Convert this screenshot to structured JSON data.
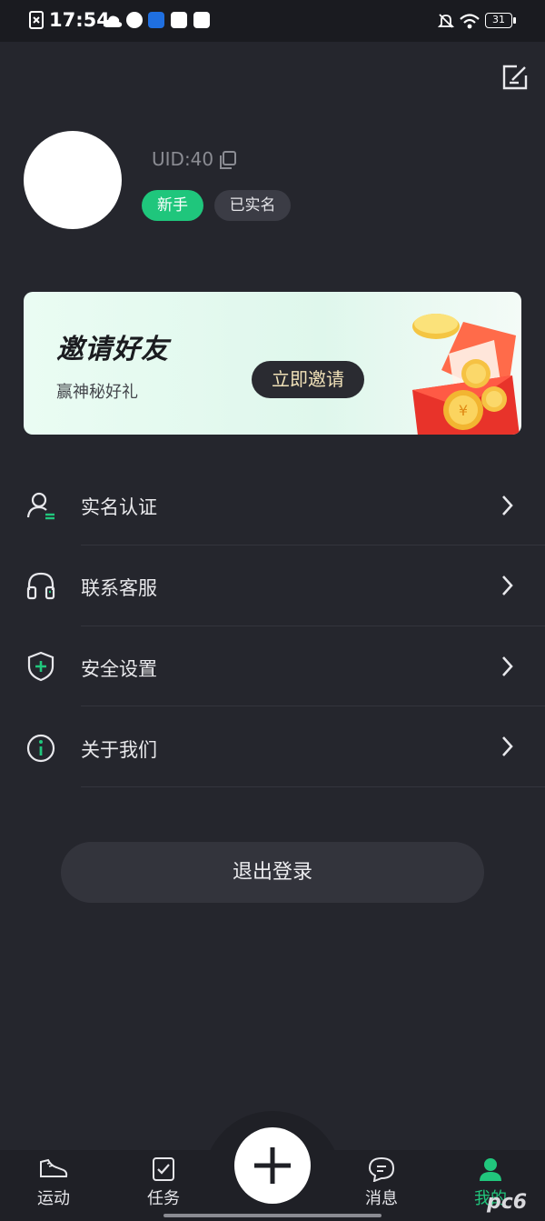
{
  "status_bar": {
    "time": "17:54",
    "battery": "31"
  },
  "profile": {
    "uid": "UID:40",
    "badge_new": "新手",
    "badge_verified": "已实名"
  },
  "banner": {
    "title": "邀请好友",
    "subtitle": "赢神秘好礼",
    "button": "立即邀请"
  },
  "menu": {
    "items": [
      {
        "label": "实名认证",
        "icon": "user-verify-icon"
      },
      {
        "label": "联系客服",
        "icon": "headset-icon"
      },
      {
        "label": "安全设置",
        "icon": "shield-plus-icon"
      },
      {
        "label": "关于我们",
        "icon": "info-icon"
      }
    ]
  },
  "logout": {
    "label": "退出登录"
  },
  "tabs": {
    "items": [
      {
        "label": "运动",
        "icon": "sneaker-icon"
      },
      {
        "label": "任务",
        "icon": "task-check-icon"
      },
      {
        "label": "消息",
        "icon": "chat-bubble-icon"
      },
      {
        "label": "我的",
        "icon": "person-icon",
        "active": true
      }
    ]
  },
  "watermark": "pc6",
  "colors": {
    "background": "#25262d",
    "accent": "#21c77d",
    "badge_new": "#1fc67c"
  }
}
